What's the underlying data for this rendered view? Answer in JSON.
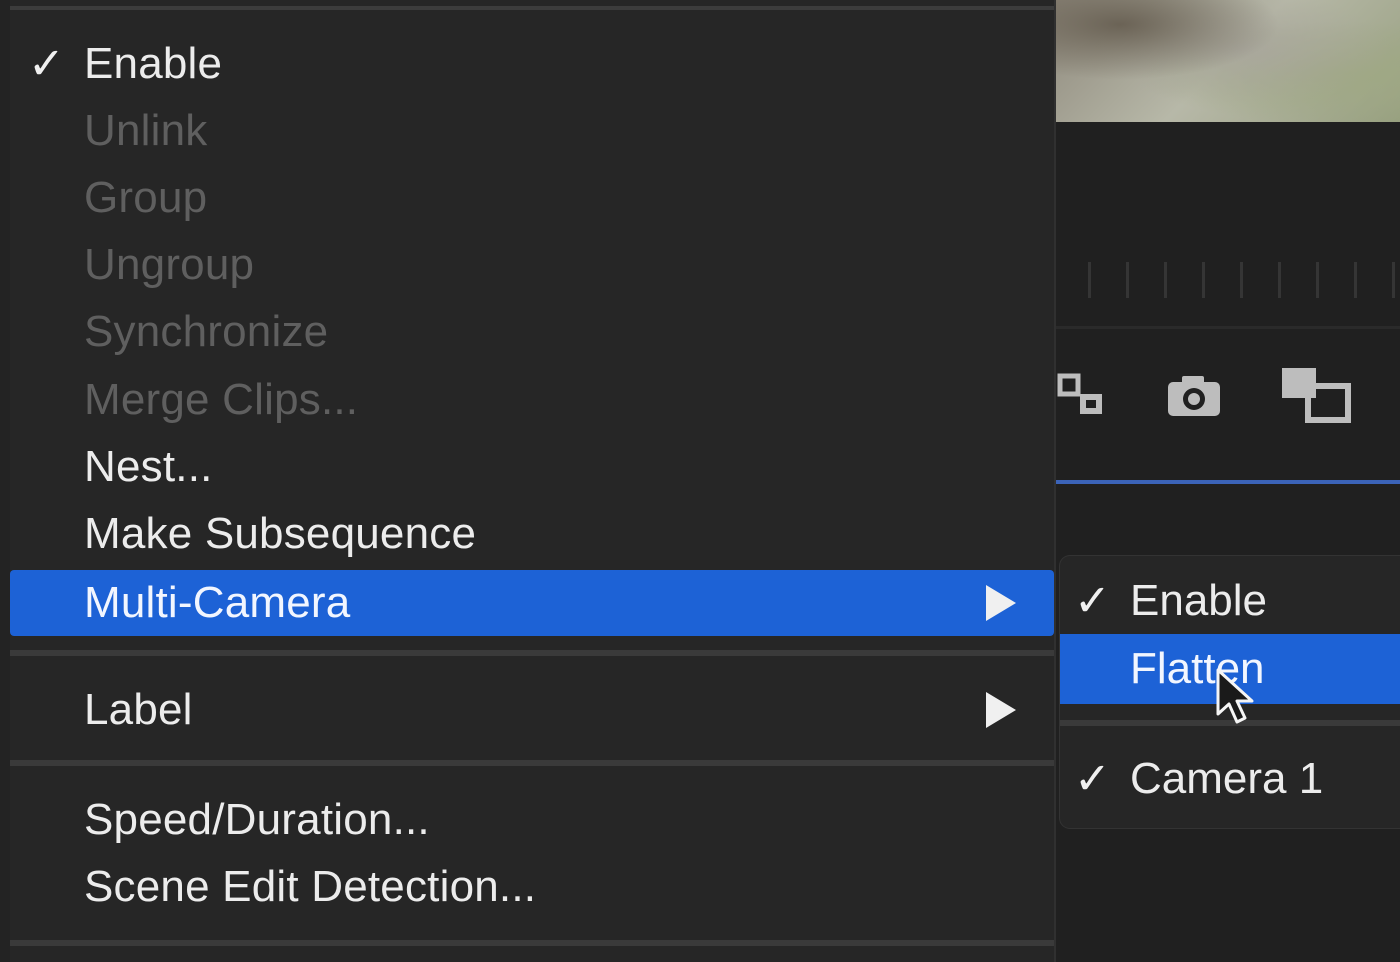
{
  "context_menu": {
    "items": [
      {
        "label": "Enable",
        "checked": true,
        "enabled": true
      },
      {
        "label": "Unlink",
        "checked": false,
        "enabled": false
      },
      {
        "label": "Group",
        "checked": false,
        "enabled": false
      },
      {
        "label": "Ungroup",
        "checked": false,
        "enabled": false
      },
      {
        "label": "Synchronize",
        "checked": false,
        "enabled": false
      },
      {
        "label": "Merge Clips...",
        "checked": false,
        "enabled": false
      },
      {
        "label": "Nest...",
        "checked": false,
        "enabled": true
      },
      {
        "label": "Make Subsequence",
        "checked": false,
        "enabled": true
      },
      {
        "label": "Multi-Camera",
        "checked": false,
        "enabled": true,
        "highlighted": true,
        "has_submenu": true
      },
      {
        "label": "Label",
        "checked": false,
        "enabled": true,
        "has_submenu": true
      },
      {
        "label": "Speed/Duration...",
        "checked": false,
        "enabled": true
      },
      {
        "label": "Scene Edit Detection...",
        "checked": false,
        "enabled": true
      }
    ],
    "check_glyph": "✓"
  },
  "multicamera_submenu": {
    "items": [
      {
        "label": "Enable",
        "checked": true
      },
      {
        "label": "Flatten",
        "checked": false,
        "highlighted": true
      },
      {
        "label": "Camera 1",
        "checked": true
      }
    ]
  },
  "colors": {
    "highlight": "#1d62d6",
    "menu_bg": "#262626",
    "disabled_text": "#5f5f5f",
    "text": "#ececec"
  },
  "icons": [
    "link-clips-icon",
    "camera-icon",
    "multi-display-icon"
  ]
}
